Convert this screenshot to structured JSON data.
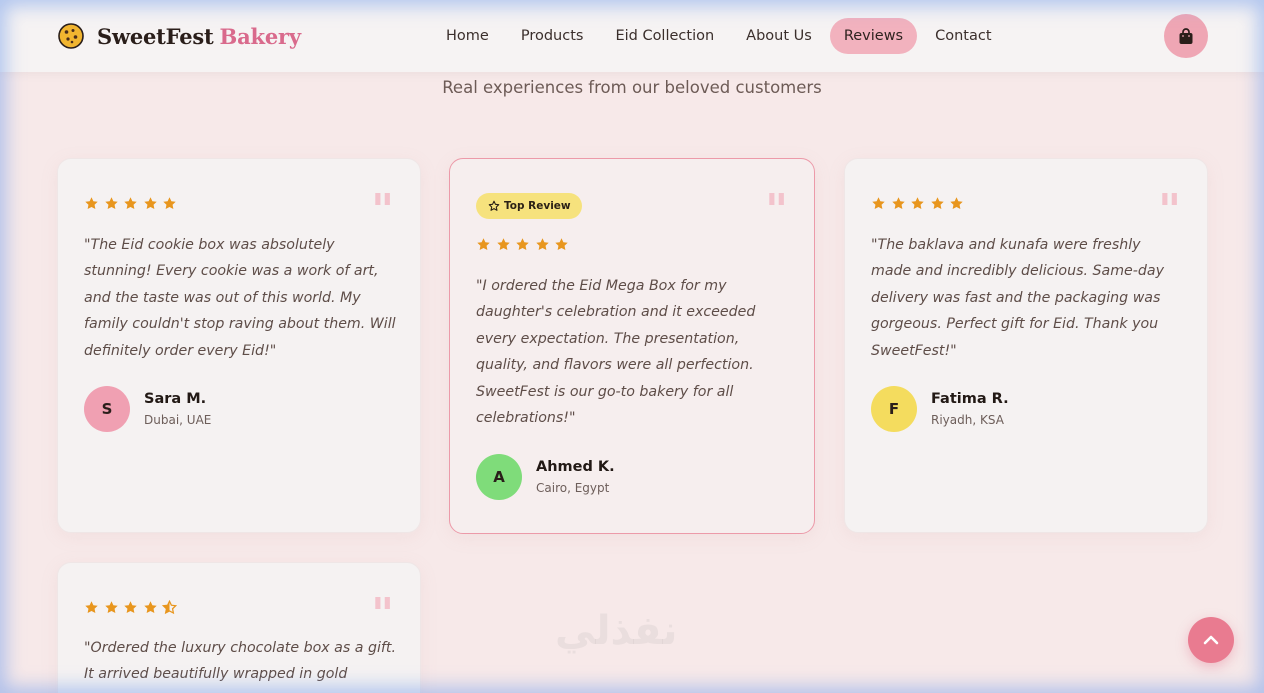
{
  "brand": {
    "name": "SweetFest",
    "accent": "Bakery",
    "accent_color": "#d96a8c",
    "icon": "cookie-icon"
  },
  "nav": {
    "items": [
      {
        "label": "Home"
      },
      {
        "label": "Products"
      },
      {
        "label": "Eid Collection"
      },
      {
        "label": "About Us"
      },
      {
        "label": "Reviews",
        "active": true
      },
      {
        "label": "Contact"
      }
    ],
    "active_color": "#f2b2be",
    "cart_icon": "shopping-bag-icon"
  },
  "section": {
    "subtitle": "Real experiences from our beloved customers"
  },
  "reviews": [
    {
      "rating": 5,
      "text": "\"The Eid cookie box was absolutely stunning! Every cookie was a work of art, and the taste was out of this world. My family couldn't stop raving about them. Will definitely order every Eid!\"",
      "initial": "S",
      "name": "Sara M.",
      "location": "Dubai, UAE",
      "avatar_color": "#f0a0b2"
    },
    {
      "rating": 5,
      "badge": "Top Review",
      "text": "\"I ordered the Eid Mega Box for my daughter's celebration and it exceeded every expectation. The presentation, quality, and flavors were all perfection. SweetFest is our go-to bakery for all celebrations!\"",
      "initial": "A",
      "name": "Ahmed K.",
      "location": "Cairo, Egypt",
      "avatar_color": "#7fdc7a"
    },
    {
      "rating": 5,
      "text": "\"The baklava and kunafa were freshly made and incredibly delicious. Same-day delivery was fast and the packaging was gorgeous. Perfect gift for Eid. Thank you SweetFest!\"",
      "initial": "F",
      "name": "Fatima R.",
      "location": "Riyadh, KSA",
      "avatar_color": "#f4dc5e"
    },
    {
      "rating": 4.5,
      "text": "\"Ordered the luxury chocolate box as a gift. It arrived beautifully wrapped in gold",
      "initial": "",
      "name": "",
      "location": ""
    }
  ],
  "colors": {
    "star": "#e8961e",
    "quote_mark": "#f3c3cc",
    "badge_bg": "#f6e27d",
    "to_top_bg": "#e97b90"
  },
  "watermark": "نفذلي",
  "to_top_icon": "chevron-up-icon"
}
